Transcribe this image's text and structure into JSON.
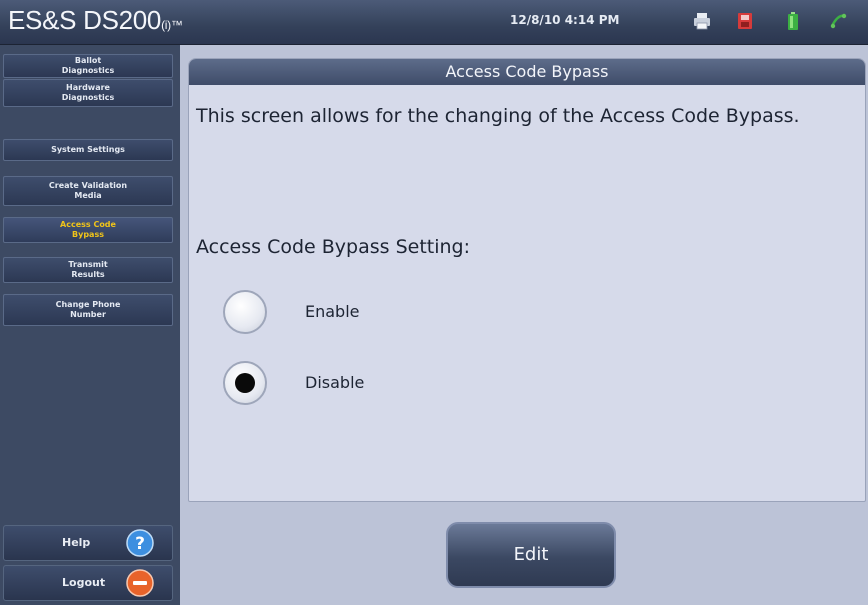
{
  "header": {
    "brand": "ES&S DS200",
    "brand_suffix": "(i)",
    "brand_tm": "™",
    "datetime": "12/8/10 4:14 PM",
    "icons": [
      "printer-icon",
      "memory-card-icon",
      "battery-icon",
      "network-icon"
    ]
  },
  "sidebar": {
    "items": [
      {
        "label": "Ballot\nDiagnostics",
        "active": false
      },
      {
        "label": "Hardware\nDiagnostics",
        "active": false
      },
      {
        "label": "System Settings",
        "active": false
      },
      {
        "label": "Create Validation\nMedia",
        "active": false
      },
      {
        "label": "Access Code\nBypass",
        "active": true
      },
      {
        "label": "Transmit\nResults",
        "active": false
      },
      {
        "label": "Change Phone\nNumber",
        "active": false
      }
    ],
    "help_label": "Help",
    "logout_label": "Logout"
  },
  "main": {
    "title": "Access Code Bypass",
    "description": "This screen allows for the changing of the Access Code Bypass.",
    "setting_label": "Access Code Bypass Setting:",
    "options": [
      {
        "label": "Enable",
        "selected": false
      },
      {
        "label": "Disable",
        "selected": true
      }
    ],
    "edit_label": "Edit"
  },
  "colors": {
    "active_nav_text": "#f0c419",
    "help_icon": "#3d8fe0",
    "logout_icon": "#e8632a"
  }
}
